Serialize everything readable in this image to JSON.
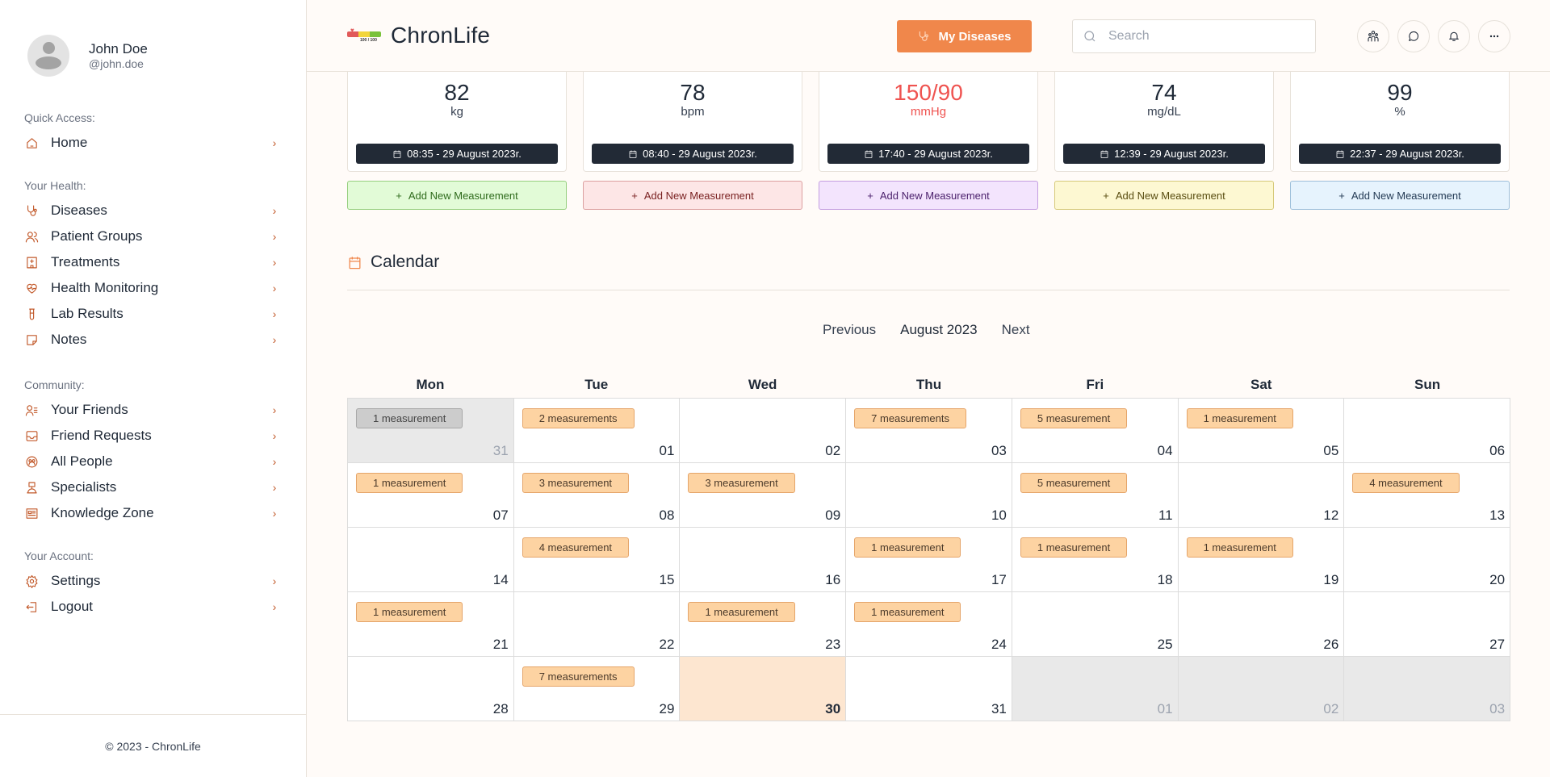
{
  "app": {
    "title": "ChronLife",
    "logo_caption": "100 / 100"
  },
  "user": {
    "name": "John Doe",
    "handle": "@john.doe"
  },
  "sidebar": {
    "sections": [
      {
        "label": "Quick Access:",
        "items": [
          {
            "label": "Home",
            "icon": "home-icon"
          }
        ]
      },
      {
        "label": "Your Health:",
        "items": [
          {
            "label": "Diseases",
            "icon": "stethoscope-icon"
          },
          {
            "label": "Patient Groups",
            "icon": "users-icon"
          },
          {
            "label": "Treatments",
            "icon": "hospital-icon"
          },
          {
            "label": "Health Monitoring",
            "icon": "heart-pulse-icon"
          },
          {
            "label": "Lab Results",
            "icon": "test-tube-icon"
          },
          {
            "label": "Notes",
            "icon": "sticky-note-icon"
          }
        ]
      },
      {
        "label": "Community:",
        "items": [
          {
            "label": "Your Friends",
            "icon": "user-list-icon"
          },
          {
            "label": "Friend Requests",
            "icon": "inbox-icon"
          },
          {
            "label": "All People",
            "icon": "people-circle-icon"
          },
          {
            "label": "Specialists",
            "icon": "specialist-icon"
          },
          {
            "label": "Knowledge Zone",
            "icon": "news-icon"
          }
        ]
      },
      {
        "label": "Your Account:",
        "items": [
          {
            "label": "Settings",
            "icon": "gear-icon"
          },
          {
            "label": "Logout",
            "icon": "logout-icon"
          }
        ]
      }
    ],
    "footer": "© 2023 - ChronLife"
  },
  "header": {
    "primary_button": "My Diseases",
    "search_placeholder": "Search",
    "search_value": "",
    "icons": [
      "community-icon",
      "chat-icon",
      "bell-icon",
      "more-icon"
    ]
  },
  "metrics": [
    {
      "value": "82",
      "unit": "kg",
      "time": "08:35 - 29 August 2023r.",
      "add_label": "Add New Measurement",
      "alert": false,
      "bg": "#e2fbd7",
      "border": "#96cf7f",
      "fg": "#2f6b1c"
    },
    {
      "value": "78",
      "unit": "bpm",
      "time": "08:40 - 29 August 2023r.",
      "add_label": "Add New Measurement",
      "alert": false,
      "bg": "#fde6e6",
      "border": "#dca0a0",
      "fg": "#7a2222"
    },
    {
      "value": "150/90",
      "unit": "mmHg",
      "time": "17:40 - 29 August 2023r.",
      "add_label": "Add New Measurement",
      "alert": true,
      "bg": "#f3e4fd",
      "border": "#c49ee0",
      "fg": "#4a1f6b"
    },
    {
      "value": "74",
      "unit": "mg/dL",
      "time": "12:39 - 29 August 2023r.",
      "add_label": "Add New Measurement",
      "alert": false,
      "bg": "#fdf8d2",
      "border": "#d6c97a",
      "fg": "#5a4e12"
    },
    {
      "value": "99",
      "unit": "%",
      "time": "22:37 - 29 August 2023r.",
      "add_label": "Add New Measurement",
      "alert": false,
      "bg": "#e6f3fd",
      "border": "#9dbfda",
      "fg": "#243b55"
    }
  ],
  "calendar": {
    "title": "Calendar",
    "prev_label": "Previous",
    "month_label": "August 2023",
    "next_label": "Next",
    "weekdays": [
      "Mon",
      "Tue",
      "Wed",
      "Thu",
      "Fri",
      "Sat",
      "Sun"
    ],
    "weeks": [
      [
        {
          "day": "31",
          "other": true,
          "badge": "1 measurement"
        },
        {
          "day": "01",
          "badge": "2 measurements"
        },
        {
          "day": "02"
        },
        {
          "day": "03",
          "badge": "7 measurements"
        },
        {
          "day": "04",
          "badge": "5 measurement"
        },
        {
          "day": "05",
          "badge": "1 measurement"
        },
        {
          "day": "06"
        }
      ],
      [
        {
          "day": "07",
          "badge": "1 measurement"
        },
        {
          "day": "08",
          "badge": "3 measurement"
        },
        {
          "day": "09",
          "badge": "3 measurement"
        },
        {
          "day": "10"
        },
        {
          "day": "11",
          "badge": "5 measurement"
        },
        {
          "day": "12"
        },
        {
          "day": "13",
          "badge": "4 measurement"
        }
      ],
      [
        {
          "day": "14"
        },
        {
          "day": "15",
          "badge": "4 measurement"
        },
        {
          "day": "16"
        },
        {
          "day": "17",
          "badge": "1 measurement"
        },
        {
          "day": "18",
          "badge": "1 measurement"
        },
        {
          "day": "19",
          "badge": "1 measurement"
        },
        {
          "day": "20"
        }
      ],
      [
        {
          "day": "21",
          "badge": "1 measurement"
        },
        {
          "day": "22"
        },
        {
          "day": "23",
          "badge": "1 measurement"
        },
        {
          "day": "24",
          "badge": "1 measurement"
        },
        {
          "day": "25"
        },
        {
          "day": "26"
        },
        {
          "day": "27"
        }
      ],
      [
        {
          "day": "28"
        },
        {
          "day": "29",
          "badge": "7 measurements"
        },
        {
          "day": "30",
          "today": true
        },
        {
          "day": "31"
        },
        {
          "day": "01",
          "other": true
        },
        {
          "day": "02",
          "other": true
        },
        {
          "day": "03",
          "other": true
        }
      ]
    ]
  },
  "colors": {
    "accent": "#f0874b",
    "icon": "#c2592a",
    "alert": "#ef5350",
    "dark": "#222a36",
    "today": "#fde6d0",
    "badge": "#fdd3a2"
  }
}
